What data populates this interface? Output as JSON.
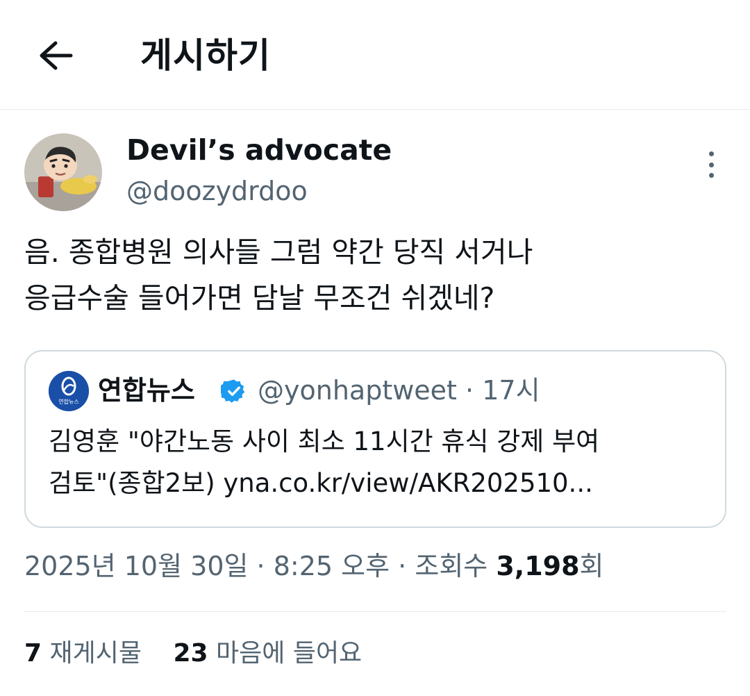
{
  "header": {
    "title": "게시하기",
    "back_icon": "arrow-left-icon"
  },
  "author": {
    "name": "Devil’s advocate",
    "handle": "@doozydrdoo",
    "avatar_icon": "avatar-cartoon-character"
  },
  "tweet": {
    "text": "음. 종합병원 의사들 그럼 약간 당직 서거나\n응급수술 들어가면 담날 무조건 쉬겠네?"
  },
  "quote": {
    "name": "연합뉴스",
    "verified_icon": "verified-badge-icon",
    "handle": "@yonhaptweet",
    "separator": "·",
    "time": "17시",
    "text": "김영훈 \"야간노동 사이 최소 11시간 휴식 강제 부여\n검토\"(종합2보) yna.co.kr/view/AKR202510...",
    "logo_text": "연합뉴스"
  },
  "meta": {
    "date": "2025년 10월 30일",
    "separator": "·",
    "time": "8:25 오후",
    "views_label": "조회수",
    "views_count": "3,198",
    "views_suffix": "회"
  },
  "stats": {
    "reposts_count": "7",
    "reposts_label": "재게시물",
    "likes_count": "23",
    "likes_label": "마음에 들어요"
  },
  "colors": {
    "text_primary": "#0f1419",
    "text_secondary": "#536471",
    "border": "#cfd9de",
    "verified": "#1d9bf0",
    "quote_logo_bg": "#1a4fa8"
  }
}
